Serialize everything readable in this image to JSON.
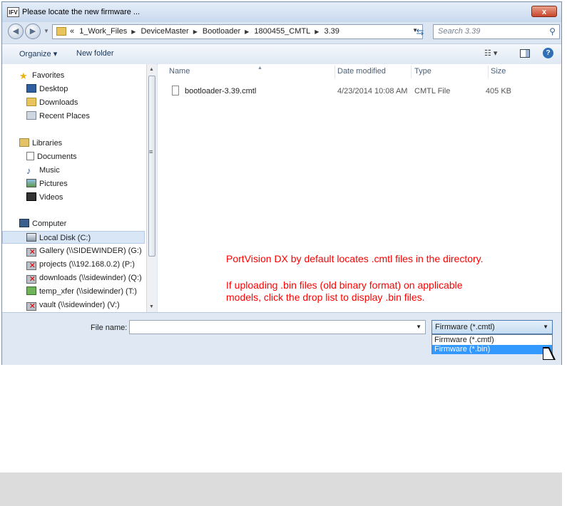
{
  "window": {
    "app_icon_text": "IFV",
    "title": "Please locate the new firmware ...",
    "close_glyph": "x"
  },
  "address_bar": {
    "overflow": "«",
    "crumbs": [
      "1_Work_Files",
      "DeviceMaster",
      "Bootloader",
      "1800455_CMTL",
      "3.39"
    ],
    "search_placeholder": "Search 3.39"
  },
  "toolbar": {
    "organize_label": "Organize ▾",
    "new_folder_label": "New folder"
  },
  "nav": {
    "favorites": {
      "label": "Favorites",
      "items": [
        "Desktop",
        "Downloads",
        "Recent Places"
      ]
    },
    "libraries": {
      "label": "Libraries",
      "items": [
        "Documents",
        "Music",
        "Pictures",
        "Videos"
      ]
    },
    "computer": {
      "label": "Computer",
      "items": [
        "Local Disk (C:)",
        "Gallery (\\\\SIDEWINDER) (G:)",
        "projects (\\\\192.168.0.2) (P:)",
        "downloads (\\\\sidewinder) (Q:)",
        "temp_xfer (\\\\sidewinder) (T:)",
        "vault (\\\\sidewinder) (V:)"
      ]
    },
    "selected": "Local Disk (C:)"
  },
  "columns": {
    "name": "Name",
    "date": "Date modified",
    "type": "Type",
    "size": "Size"
  },
  "files": [
    {
      "name": "bootloader-3.39.cmtl",
      "date": "4/23/2014 10:08 AM",
      "type": "CMTL File",
      "size": "405 KB"
    }
  ],
  "annotation": {
    "line1": "PortVision DX by default locates .cmtl files in the directory.",
    "line2": "If uploading .bin files (old binary format) on applicable",
    "line3": "models, click the drop list to display .bin files.",
    "color": "#ff0000"
  },
  "bottom": {
    "file_name_label": "File name:",
    "file_name_value": "",
    "filter_selected": "Firmware (*.cmtl)",
    "filter_options": [
      "Firmware (*.cmtl)",
      "Firmware (*.bin)"
    ],
    "highlighted_option": "Firmware (*.bin)"
  }
}
